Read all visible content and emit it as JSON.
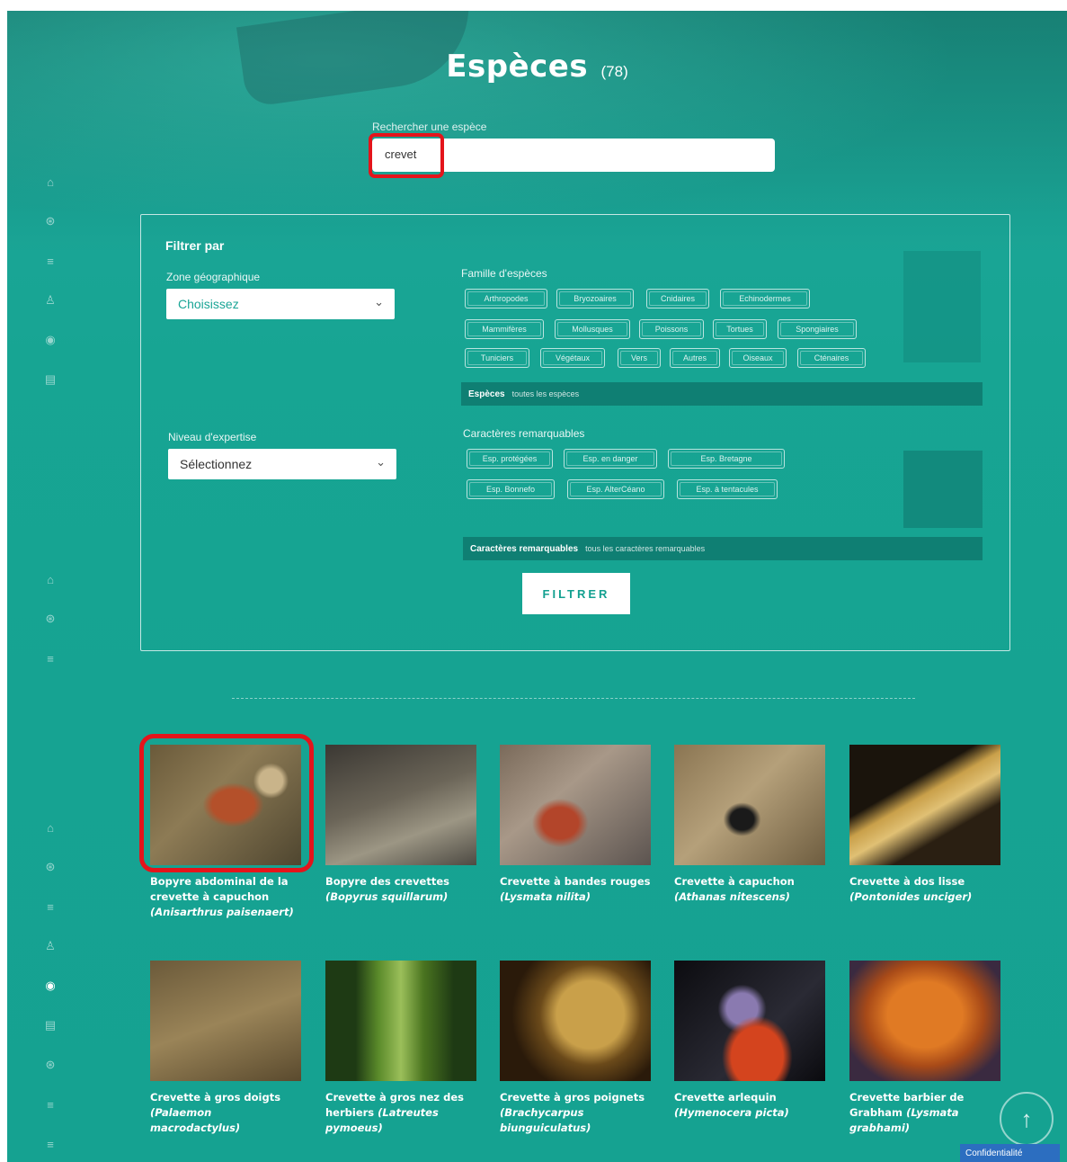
{
  "header": {
    "title": "Espèces",
    "count": "(78)"
  },
  "search": {
    "label": "Rechercher une espèce",
    "value": "crevet"
  },
  "filter": {
    "title": "Filtrer par",
    "zone_label": "Zone géographique",
    "zone_value": "Choisissez",
    "family_label": "Famille d'espèces",
    "family_chips": [
      "Arthropodes",
      "Bryozoaires",
      "Cnidaires",
      "Echinodermes",
      "Mammifères",
      "Mollusques",
      "Poissons",
      "Tortues",
      "Spongiaires",
      "Tuniciers",
      "Végétaux",
      "Vers",
      "Autres",
      "Oiseaux",
      "Cténaires"
    ],
    "species_bar_label": "Espèces",
    "species_bar_value": "toutes les espèces",
    "level_label": "Niveau d'expertise",
    "level_value": "Sélectionnez",
    "remarkable_label": "Caractères remarquables",
    "remarkable_chips": [
      "Esp. protégées",
      "Esp. en danger",
      "Esp. Bretagne",
      "Esp. Bonnefo",
      "Esp. AlterCéano",
      "Esp. à tentacules"
    ],
    "remarkable_bar_label": "Caractères remarquables",
    "remarkable_bar_value": "tous les caractères remarquables",
    "button": "FILTRER"
  },
  "results": [
    {
      "name": "Bopyre abdominal de la crevette à capuchon",
      "latin": "(Anisarthrus paisenaert)"
    },
    {
      "name": "Bopyre des crevettes",
      "latin": "(Bopyrus squillarum)"
    },
    {
      "name": "Crevette à bandes rouges",
      "latin": "(Lysmata nilita)"
    },
    {
      "name": "Crevette à capuchon",
      "latin": "(Athanas nitescens)"
    },
    {
      "name": "Crevette à dos lisse",
      "latin": "(Pontonides unciger)"
    },
    {
      "name": "Crevette à gros doigts",
      "latin": "(Palaemon macrodactylus)"
    },
    {
      "name": "Crevette à gros nez des herbiers",
      "latin": "(Latreutes pymoeus)"
    },
    {
      "name": "Crevette à gros poignets",
      "latin": "(Brachycarpus biunguiculatus)"
    },
    {
      "name": "Crevette arlequin",
      "latin": "(Hymenocera picta)"
    },
    {
      "name": "Crevette barbier de Grabham",
      "latin": "(Lysmata grabhami)"
    }
  ],
  "footer": {
    "scroll_top": "↑",
    "confidentiality": "Confidentialité"
  },
  "icons": [
    "home-icon",
    "compass-icon",
    "menu-icon",
    "user-icon",
    "eye-icon",
    "book-icon"
  ]
}
